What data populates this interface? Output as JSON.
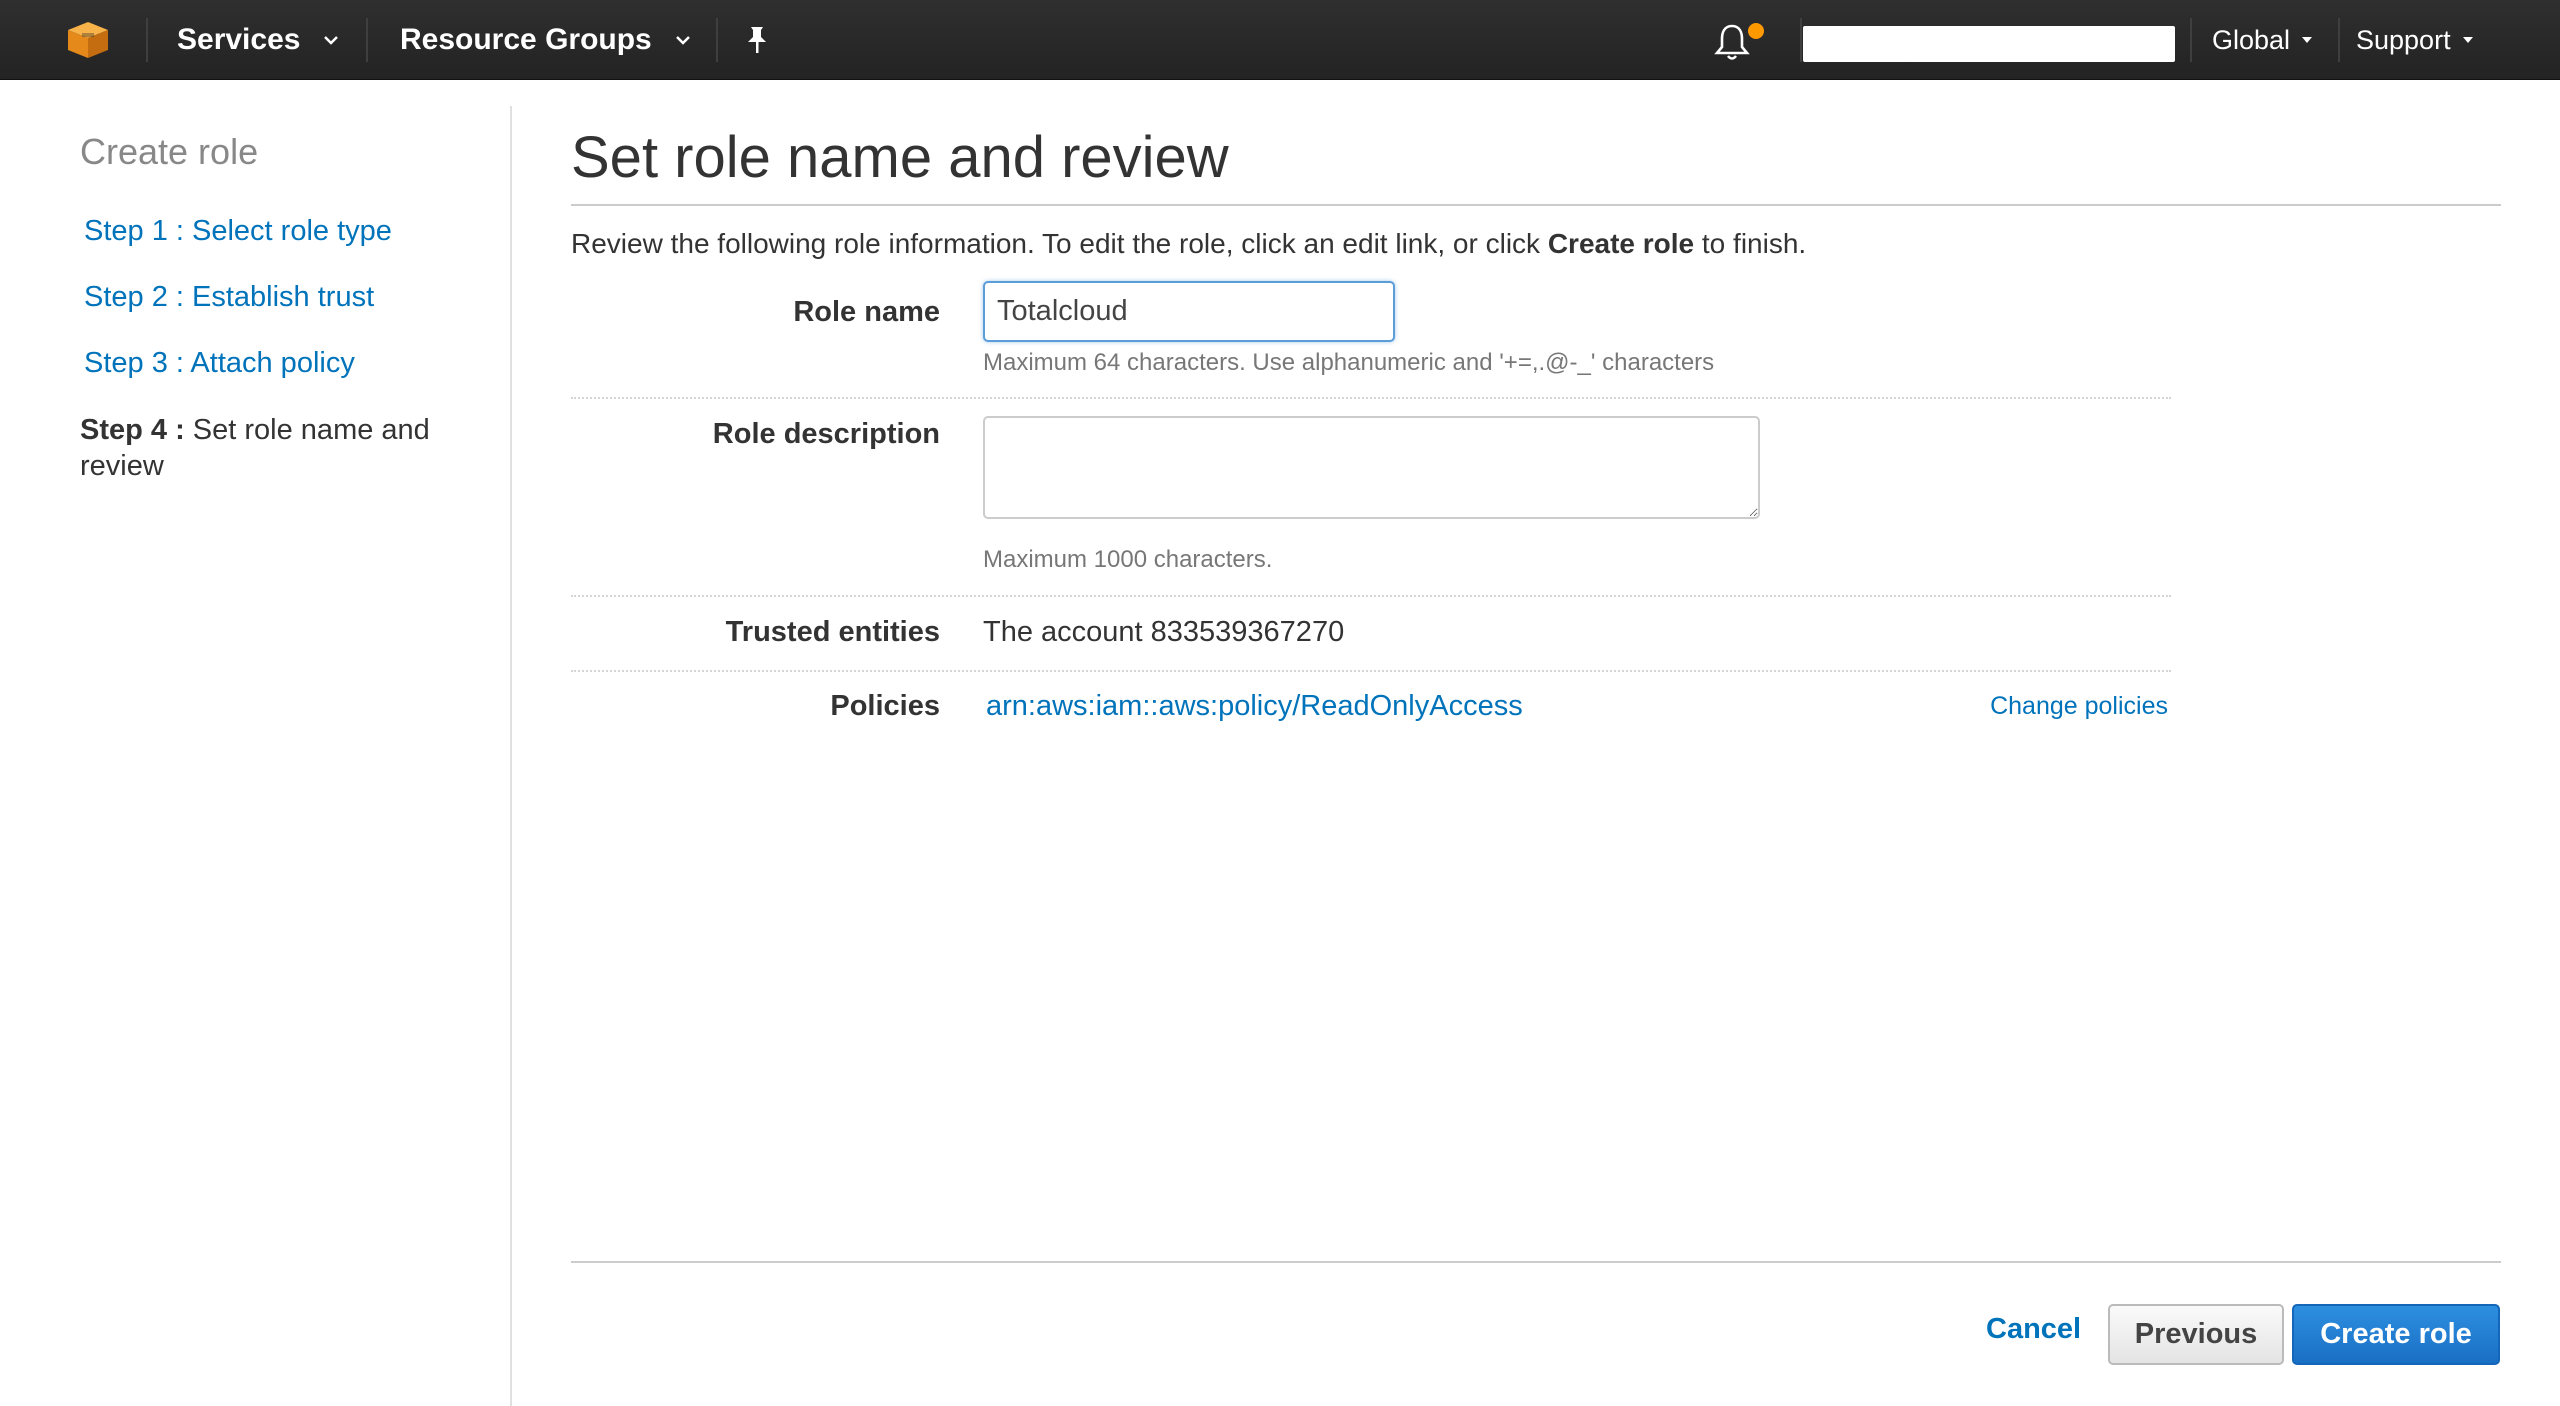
{
  "topnav": {
    "services_label": "Services",
    "resource_groups_label": "Resource Groups",
    "region_label": "Global",
    "support_label": "Support",
    "logo_icon": "aws-cube-icon",
    "pin_icon": "pin-icon",
    "bell_icon": "bell-icon",
    "notification_color": "#ff9900",
    "account_name": ""
  },
  "sidebar": {
    "title": "Create role",
    "steps": [
      {
        "label": "Step 1 : Select role type"
      },
      {
        "label": "Step 2 : Establish trust"
      },
      {
        "label": "Step 3 : Attach policy"
      }
    ],
    "current_step_prefix": "Step 4 :",
    "current_step_label": " Set role name and review"
  },
  "main": {
    "title": "Set role name and review",
    "intro_before": "Review the following role information. To edit the role, click an edit link, or click ",
    "intro_bold": "Create role",
    "intro_after": " to finish.",
    "role_name": {
      "label": "Role name",
      "value": "Totalcloud",
      "hint": "Maximum 64 characters. Use alphanumeric and '+=,.@-_' characters"
    },
    "role_description": {
      "label": "Role description",
      "value": "",
      "hint": "Maximum 1000 characters."
    },
    "trusted_entities": {
      "label": "Trusted entities",
      "value": "The account 833539367270"
    },
    "policies": {
      "label": "Policies",
      "policy_arn": "arn:aws:iam::aws:policy/ReadOnlyAccess",
      "change_label": "Change policies"
    }
  },
  "footer": {
    "cancel_label": "Cancel",
    "previous_label": "Previous",
    "create_label": "Create role"
  },
  "colors": {
    "nav_bg": "#2a2a2a",
    "link": "#0073bb",
    "primary_button": "#1a6fc4",
    "logo_orange": "#f7981d"
  }
}
